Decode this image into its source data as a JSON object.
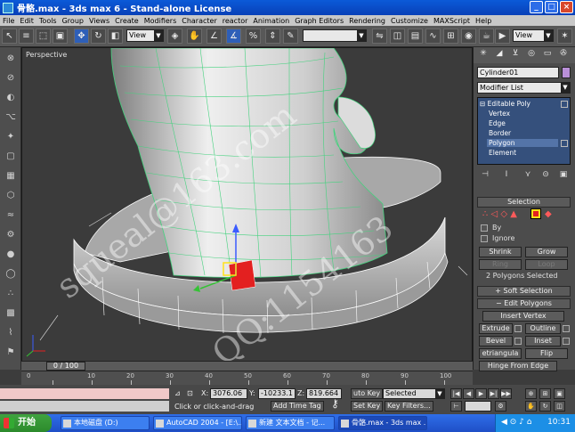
{
  "window": {
    "title": "骨骼.max - 3ds max 6 - Stand-alone License",
    "buttons": [
      "_",
      "□",
      "×"
    ]
  },
  "menu": [
    "File",
    "Edit",
    "Tools",
    "Group",
    "Views",
    "Create",
    "Modifiers",
    "Character",
    "reactor",
    "Animation",
    "Graph Editors",
    "Rendering",
    "Customize",
    "MAXScript",
    "Help"
  ],
  "toolbar": {
    "view_dropdown_left": "View",
    "view_dropdown_right": "View",
    "named_selection": ""
  },
  "viewport": {
    "label": "Perspective",
    "watermark_1": "squeal@163.com",
    "watermark_2": "QQ:1154163"
  },
  "command_panel": {
    "object_name": "Cylinder01",
    "object_color": "#b98fd8",
    "modifier_list": "Modifier List",
    "stack": [
      "Editable Poly",
      "Vertex",
      "Edge",
      "Border",
      "Polygon",
      "Element"
    ],
    "stack_selected": "Polygon",
    "selection_title": "Selection",
    "by_label": "By",
    "ignore_label": "Ignore",
    "shrink": "Shrink",
    "grow": "Grow",
    "ring": "Ring",
    "loop": "Loop",
    "selection_status": "2 Polygons Selected",
    "soft_selection_title": "Soft Selection",
    "edit_polygons_title": "Edit Polygons",
    "insert_vertex": "Insert Vertex",
    "extrude": "Extrude",
    "outline": "Outline",
    "bevel": "Bevel",
    "inset": "Inset",
    "retriangulate": "etriangula",
    "flip": "Flip",
    "hinge_from_edge": "Hinge From Edge",
    "extrude_along_spline": "xtrude Along Solin"
  },
  "timeline": {
    "slider": "0 / 100",
    "ticks": [
      "0",
      "10",
      "20",
      "30",
      "40",
      "50",
      "60",
      "70",
      "80",
      "90",
      "100"
    ]
  },
  "status": {
    "x_label": "X:",
    "x_value": "3076.06",
    "y_label": "Y:",
    "y_value": "-10233.1",
    "z_label": "Z:",
    "z_value": "819.664",
    "prompt": "Click or click-and-drag",
    "add_time_tag": "Add Time Tag",
    "auto_key": "uto Key",
    "selected": "Selected",
    "set_key": "Set Key",
    "key_filters": "Key Filters..."
  },
  "taskbar": {
    "start": "开始",
    "tasks": [
      "本地磁盘 (D:)",
      "AutoCAD 2004 - [E:\\...",
      "新建 文本文档 - 记...",
      "骨骼.max - 3ds max ..."
    ],
    "clock": "10:31"
  },
  "colors": {
    "title_blue": "#0b5ad8",
    "wire_green": "#33d17a",
    "selected_red": "#e32020",
    "gizmo_yellow": "#ffe11a"
  }
}
